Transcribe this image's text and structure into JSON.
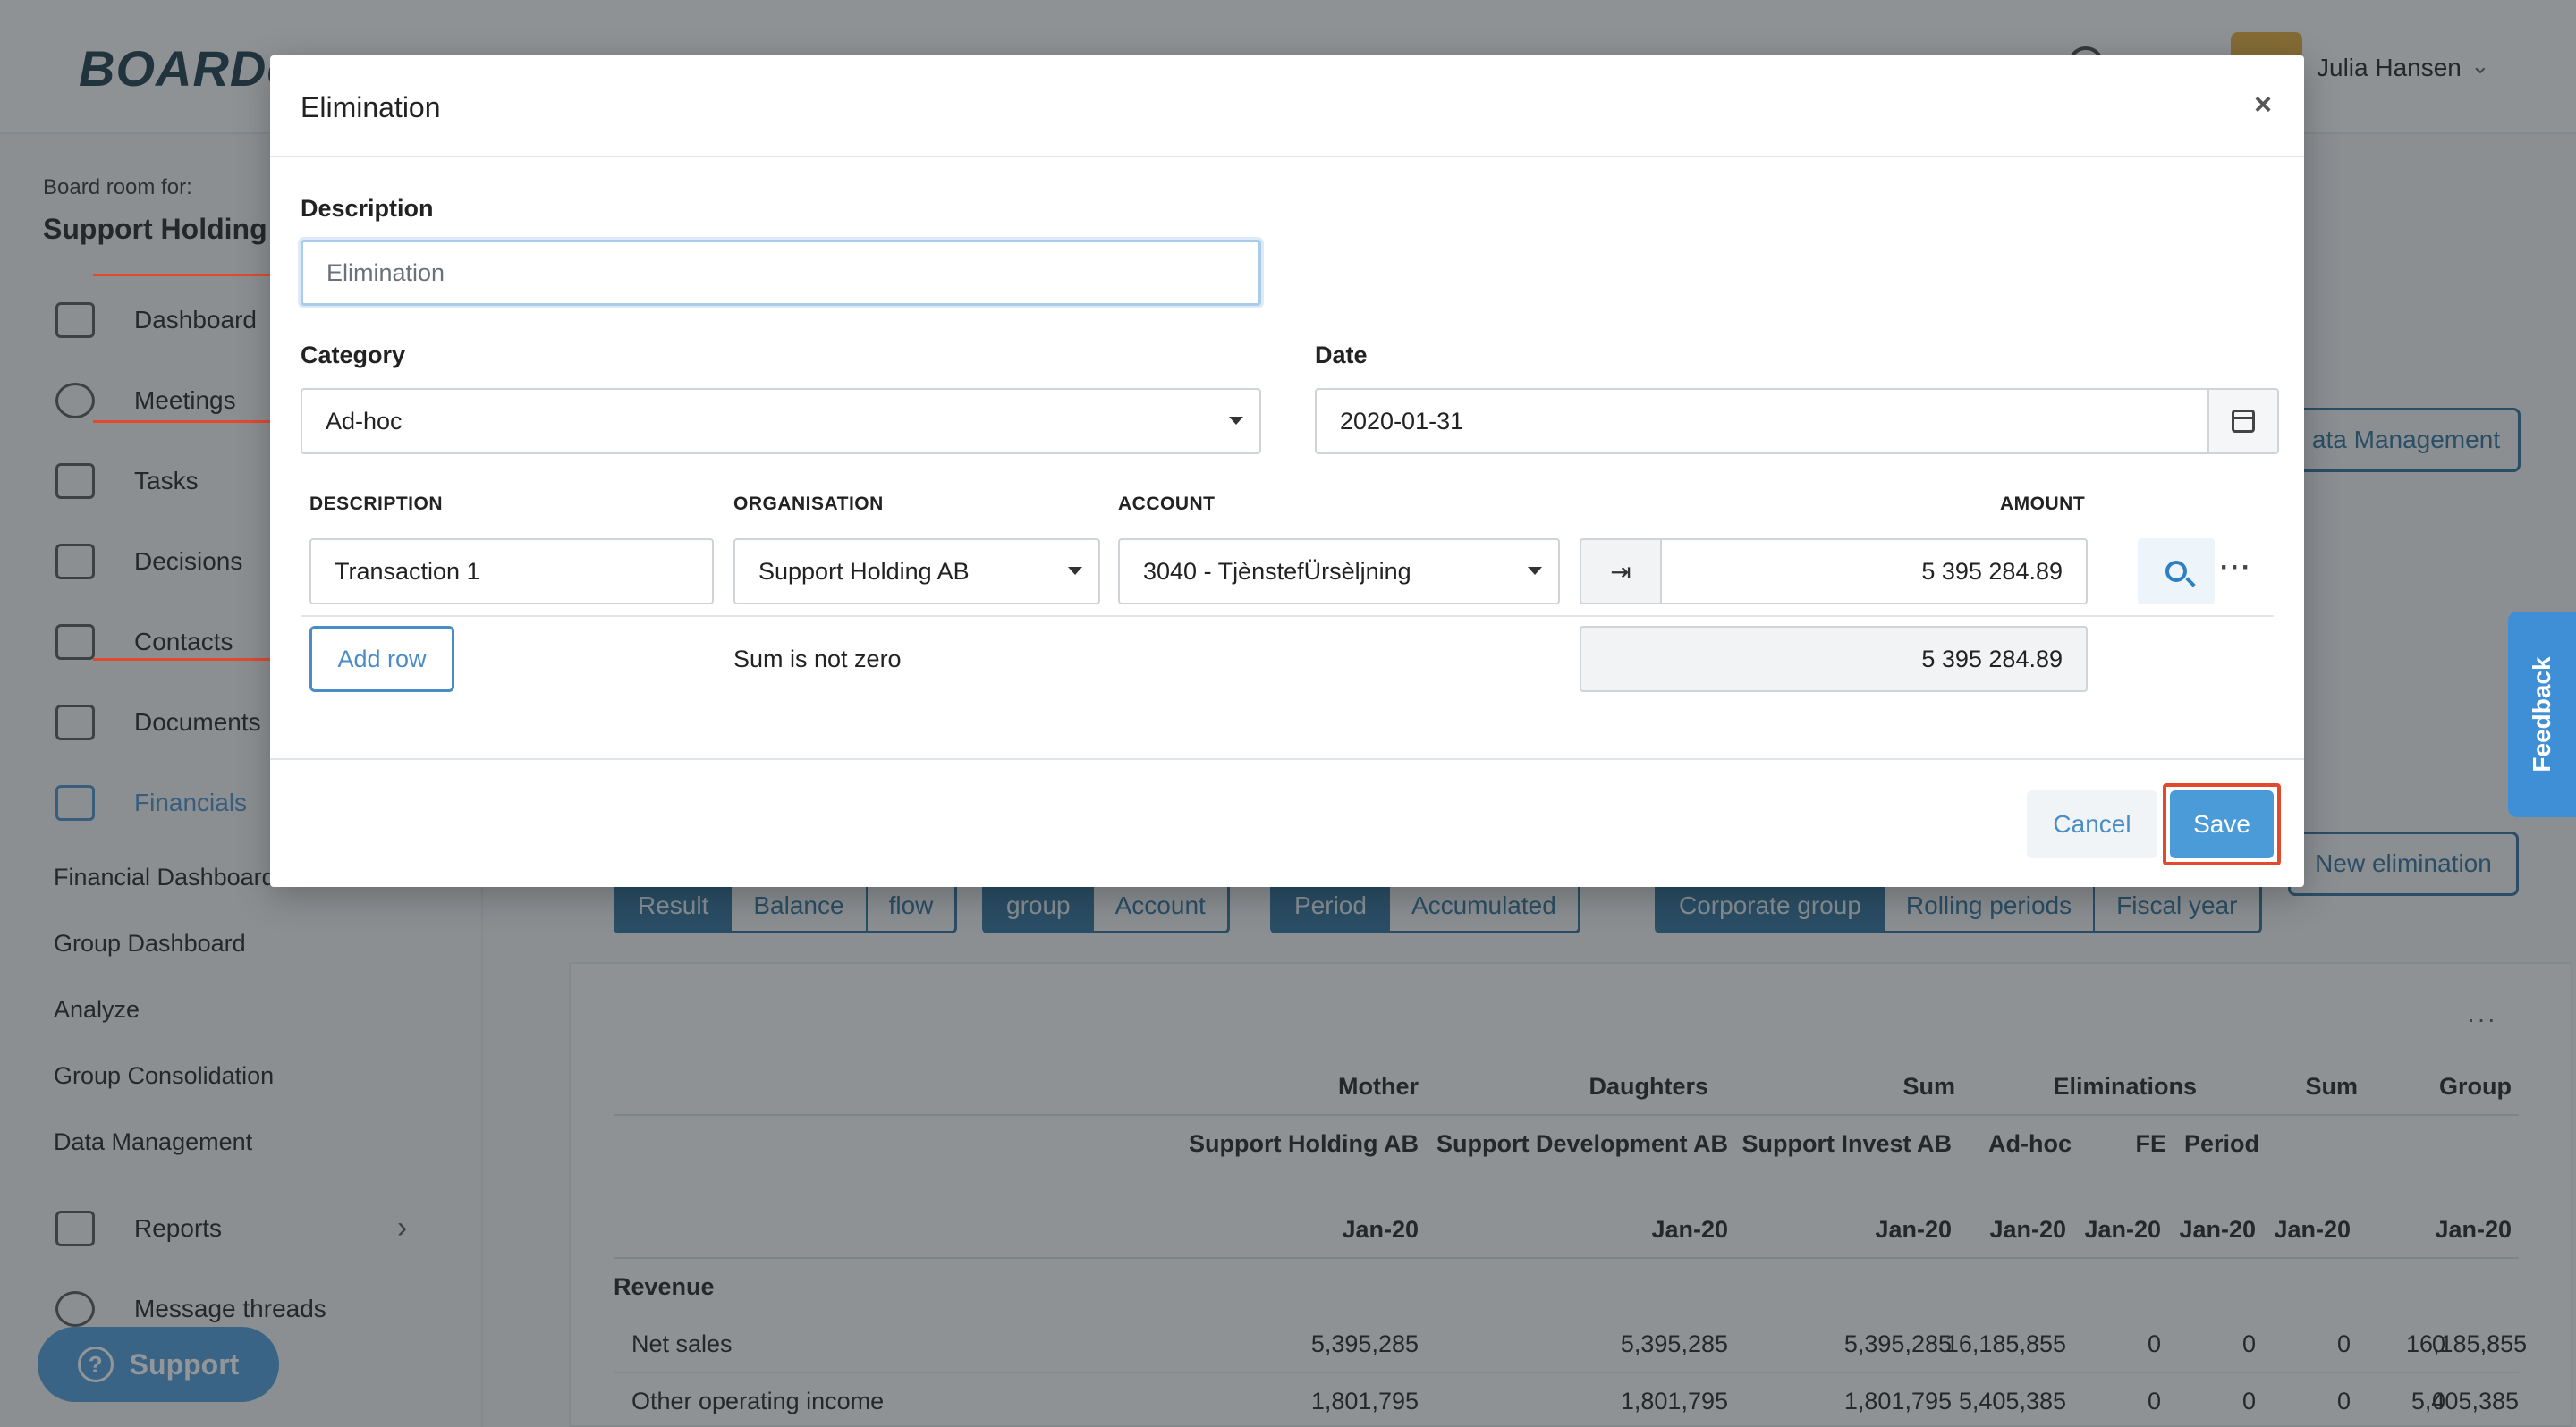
{
  "app": {
    "logo": "BOARD",
    "logo_suffix": "e",
    "user_name": "Julia Hansen"
  },
  "sidebar": {
    "board_for_label": "Board room for:",
    "board_name": "Support Holding AB",
    "items": [
      {
        "label": "Dashboard",
        "icon": "calendar-icon"
      },
      {
        "label": "Meetings",
        "icon": "clock-icon"
      },
      {
        "label": "Tasks",
        "icon": "list-icon"
      },
      {
        "label": "Decisions",
        "icon": "gavel-icon"
      },
      {
        "label": "Contacts",
        "icon": "contacts-icon"
      },
      {
        "label": "Documents",
        "icon": "document-icon"
      },
      {
        "label": "Financials",
        "icon": "chart-icon",
        "active": true
      }
    ],
    "financial_sub": [
      "Financial Dashboard",
      "Group Dashboard",
      "Analyze",
      "Group Consolidation",
      "Data Management"
    ],
    "reports": "Reports",
    "message_threads": "Message threads",
    "support": "Support"
  },
  "background": {
    "data_management_btn": "ata Management",
    "new_elimination_btn": "New elimination",
    "seg1": [
      "Result",
      "Balance",
      "flow"
    ],
    "seg2": [
      "group",
      "Account"
    ],
    "seg3": [
      "Period",
      "Accumulated"
    ],
    "seg4": [
      "Corporate group",
      "Rolling periods",
      "Fiscal year"
    ],
    "feedback": "Feedback",
    "table": {
      "header1": [
        "Mother",
        "Daughters",
        "Sum",
        "Eliminations",
        "Sum",
        "Group"
      ],
      "header2": [
        "Support Holding AB",
        "Support Development AB",
        "Support Invest AB",
        "Ad-hoc",
        "FE",
        "Period"
      ],
      "header3": [
        "Jan-20",
        "Jan-20",
        "Jan-20",
        "Jan-20",
        "Jan-20",
        "Jan-20",
        "Jan-20",
        "Jan-20",
        "Jan-20"
      ],
      "section": "Revenue",
      "rows": [
        {
          "label": "Net sales",
          "values": [
            "5,395,285",
            "5,395,285",
            "5,395,285",
            "16,185,855",
            "0",
            "0",
            "0",
            "0",
            "16,185,855"
          ]
        },
        {
          "label": "Other operating income",
          "values": [
            "1,801,795",
            "1,801,795",
            "1,801,795",
            "5,405,385",
            "0",
            "0",
            "0",
            "0",
            "5,405,385"
          ]
        }
      ]
    }
  },
  "modal": {
    "title": "Elimination",
    "close": "×",
    "description_label": "Description",
    "description_placeholder": "Elimination",
    "category_label": "Category",
    "category_value": "Ad-hoc",
    "date_label": "Date",
    "date_value": "2020-01-31",
    "columns": {
      "description": "DESCRIPTION",
      "organisation": "ORGANISATION",
      "account": "ACCOUNT",
      "amount": "AMOUNT"
    },
    "row": {
      "description": "Transaction 1",
      "organisation": "Support Holding AB",
      "account": "3040 - TjènstefÜrsèljning",
      "amount": "5 395 284.89"
    },
    "add_row": "Add row",
    "sum_message": "Sum is not zero",
    "sum_total": "5 395 284.89",
    "cancel": "Cancel",
    "save": "Save"
  },
  "colors": {
    "accent": "#4a9bd8",
    "annotation": "#e24a2e",
    "brand_dark": "#2d6e98"
  }
}
